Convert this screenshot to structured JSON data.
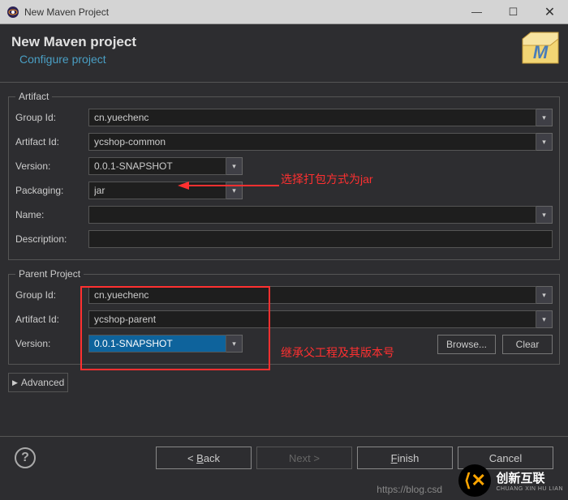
{
  "window": {
    "title": "New Maven Project",
    "minimize": "—",
    "maximize": "☐",
    "close": "✕"
  },
  "header": {
    "title": "New Maven project",
    "subtitle": "Configure project"
  },
  "artifact": {
    "legend": "Artifact",
    "groupIdLabel": "Group Id:",
    "groupId": "cn.yuechenc",
    "artifactIdLabel": "Artifact Id:",
    "artifactId": "ycshop-common",
    "versionLabel": "Version:",
    "version": "0.0.1-SNAPSHOT",
    "packagingLabel": "Packaging:",
    "packaging": "jar",
    "nameLabel": "Name:",
    "name": "",
    "descriptionLabel": "Description:",
    "description": ""
  },
  "parent": {
    "legend": "Parent Project",
    "groupIdLabel": "Group Id:",
    "groupId": "cn.yuechenc",
    "artifactIdLabel": "Artifact Id:",
    "artifactId": "ycshop-parent",
    "versionLabel": "Version:",
    "version": "0.0.1-SNAPSHOT",
    "browseLabel": "Browse...",
    "clearLabel": "Clear"
  },
  "advanced": "Advanced",
  "annotations": {
    "packaging": "选择打包方式为jar",
    "parent": "继承父工程及其版本号"
  },
  "nav": {
    "back": "Back",
    "backPrefix": "< ",
    "next": "Next >",
    "finish": "Finish",
    "cancel": "Cancel"
  },
  "watermark": {
    "brand": "创新互联",
    "sub": "CHUANG XIN HU LIAN",
    "url": "https://blog.csd"
  }
}
